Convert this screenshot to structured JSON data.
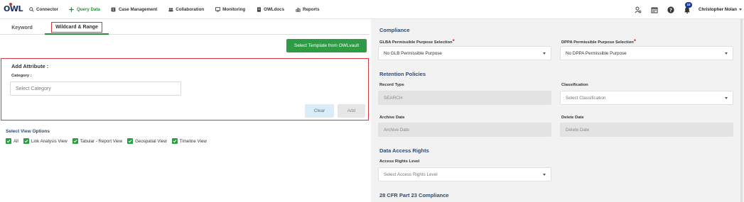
{
  "app": {
    "logo_text": "OWL",
    "nav": [
      {
        "label": "Connector",
        "icon": "search-icon"
      },
      {
        "label": "Query Data",
        "icon": "crosshair-icon",
        "active": true
      },
      {
        "label": "Case Management",
        "icon": "folder-icon"
      },
      {
        "label": "Collaboration",
        "icon": "users-icon"
      },
      {
        "label": "Monitoring",
        "icon": "monitor-icon"
      },
      {
        "label": "OWLdocs",
        "icon": "document-icon"
      },
      {
        "label": "Reports",
        "icon": "chart-icon"
      }
    ],
    "notification_count": "10",
    "user_name": "Christopher Nolan"
  },
  "tabs": {
    "keyword": "Keyword",
    "wildcard": "Wildcard & Range"
  },
  "left": {
    "template_button": "Select Template from OWLvault",
    "add_attribute_title": "Add Attribute :",
    "category_label": "Category :",
    "category_placeholder": "Select Category",
    "clear_button": "Clear",
    "add_button": "Add",
    "view_options_title": "Select View Options",
    "view_options": [
      "All",
      "Link Analysis View",
      "Tabular - Report View",
      "Geospatial View",
      "Timeline View"
    ]
  },
  "right": {
    "compliance_title": "Compliance",
    "glba_label": "GLBA Permissible Purpose Selection",
    "glba_value": "No GLB Permissible Purpose",
    "dppa_label": "DPPA Permissible Purpose Selection",
    "dppa_value": "No DPPA Permissible Purpose",
    "retention_title": "Retention Policies",
    "record_type_label": "Record Type",
    "record_type_value": "SEARCH",
    "classification_label": "Classification",
    "classification_placeholder": "Select Classification",
    "archive_label": "Archive Date",
    "archive_placeholder": "Archive Date",
    "delete_label": "Delete Date",
    "delete_placeholder": "Delete Date",
    "access_title": "Data Access Rights",
    "access_level_label": "Access Rights Level",
    "access_level_placeholder": "Select Access Rights Level",
    "cfr_title": "28 CFR Part 23 Compliance",
    "required_mark": "*"
  },
  "colors": {
    "accent_green": "#2e9b45",
    "highlight_red": "#d9363e",
    "section_blue": "#2c4a74",
    "badge_blue": "#1a3a8f"
  }
}
